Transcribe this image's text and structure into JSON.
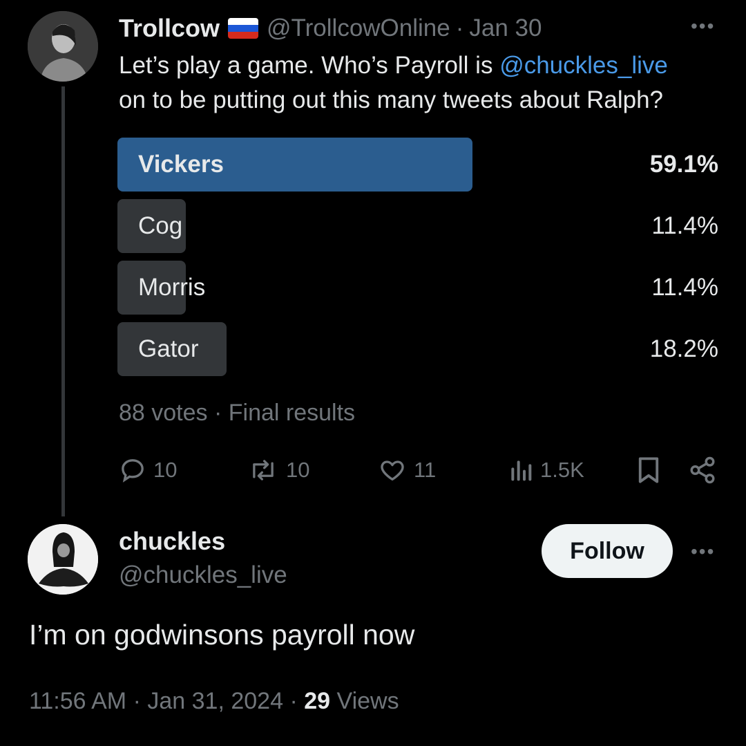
{
  "quoted_tweet": {
    "author_name": "Trollcow",
    "flag": "Russia flag",
    "handle": "@TrollcowOnline",
    "date": "Jan 30",
    "text_before_mention": "Let’s play a game. Who’s Payroll is ",
    "mention": "@chuckles_live",
    "text_after_mention": "on to be putting out this many tweets about Ralph?",
    "poll": {
      "options": [
        {
          "label": "Vickers",
          "percent": "59.1%",
          "fraction": 0.591,
          "winner": true
        },
        {
          "label": "Cog",
          "percent": "11.4%",
          "fraction": 0.114,
          "winner": false
        },
        {
          "label": "Morris",
          "percent": "11.4%",
          "fraction": 0.114,
          "winner": false
        },
        {
          "label": "Gator",
          "percent": "18.2%",
          "fraction": 0.182,
          "winner": false
        }
      ],
      "votes": "88 votes",
      "status": "Final results"
    },
    "actions": {
      "replies": "10",
      "reposts": "10",
      "likes": "11",
      "views": "1.5K"
    }
  },
  "reply": {
    "author_name": "chuckles",
    "handle": "@chuckles_live",
    "follow_label": "Follow",
    "text": "I’m on godwinsons payroll now",
    "time": "11:56 AM",
    "date": "Jan 31, 2024",
    "views_count": "29",
    "views_label": "Views"
  },
  "colors": {
    "background": "#000000",
    "accent_blue": "#4a9ae8",
    "poll_winner": "#2b5d8f",
    "poll_bar": "#333639",
    "muted": "#71767b"
  }
}
